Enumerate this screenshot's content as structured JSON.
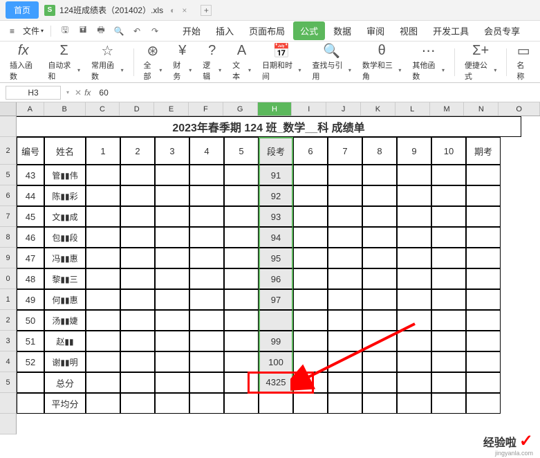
{
  "titleBar": {
    "homeTab": "首页",
    "fileIcon": "S",
    "fileName": "124班成绩表（201402）.xls",
    "addTab": "+"
  },
  "menuBar": {
    "menuIcon": "≡",
    "fileMenu": "文件",
    "tabs": [
      "开始",
      "插入",
      "页面布局",
      "公式",
      "数据",
      "审阅",
      "视图",
      "开发工具",
      "会员专享"
    ],
    "activeTab": "公式"
  },
  "ribbon": {
    "insertFn": "插入函数",
    "autoSum": "自动求和",
    "common": "常用函数",
    "all": "全部",
    "financial": "财务",
    "logical": "逻辑",
    "text": "文本",
    "dateTime": "日期和时间",
    "lookup": "查找与引用",
    "math": "数学和三角",
    "other": "其他函数",
    "convenient": "便捷公式",
    "nameMgr": "名称"
  },
  "formulaBar": {
    "nameBox": "H3",
    "formulaValue": "60"
  },
  "colHeaders": [
    "A",
    "B",
    "C",
    "D",
    "E",
    "F",
    "G",
    "H",
    "I",
    "J",
    "K",
    "L",
    "M",
    "N",
    "O"
  ],
  "rowHeaders": [
    "",
    "2",
    "5",
    "6",
    "7",
    "8",
    "9",
    "0",
    "1",
    "2",
    "3",
    "4",
    "5",
    "",
    ""
  ],
  "sheet": {
    "title": "2023年春季期 124 班_数学__科 成绩单",
    "headers": {
      "col1": "编号",
      "col2": "姓名",
      "cols": [
        "1",
        "2",
        "3",
        "4",
        "5",
        "段考",
        "6",
        "7",
        "8",
        "9",
        "10",
        "期考"
      ]
    },
    "rows": [
      {
        "num": "43",
        "name": "管▮▮伟",
        "h": "91"
      },
      {
        "num": "44",
        "name": "陈▮▮彩",
        "h": "92"
      },
      {
        "num": "45",
        "name": "文▮▮成",
        "h": "93"
      },
      {
        "num": "46",
        "name": "包▮▮段",
        "h": "94"
      },
      {
        "num": "47",
        "name": "冯▮▮惠",
        "h": "95"
      },
      {
        "num": "48",
        "name": "黎▮▮三",
        "h": "96"
      },
      {
        "num": "49",
        "name": "何▮▮惠",
        "h": "97"
      },
      {
        "num": "50",
        "name": "汤▮▮婕",
        "h": ""
      },
      {
        "num": "51",
        "name": "赵▮▮",
        "h": "99"
      },
      {
        "num": "52",
        "name": "谢▮▮明",
        "h": "100"
      }
    ],
    "totalRow": {
      "label": "总分",
      "h": "4325"
    },
    "avgRow": {
      "label": "平均分"
    }
  },
  "watermark": {
    "text": "经验啦",
    "check": "✓",
    "url": "jingyanla.com"
  }
}
